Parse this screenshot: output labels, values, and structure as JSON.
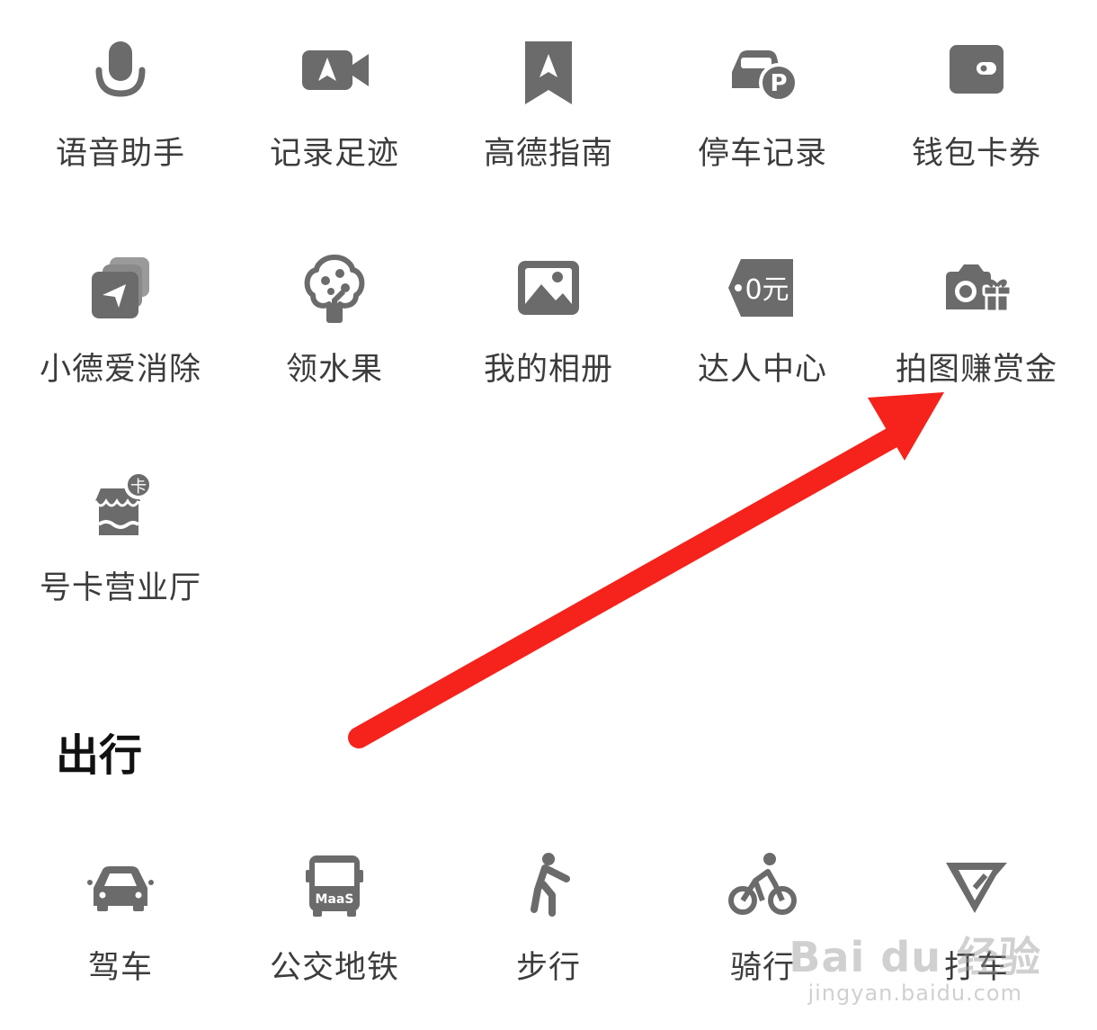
{
  "tools": [
    {
      "label": "语音助手",
      "icon": "microphone-icon"
    },
    {
      "label": "记录足迹",
      "icon": "video-camera-icon"
    },
    {
      "label": "高德指南",
      "icon": "bookmark-icon"
    },
    {
      "label": "停车记录",
      "icon": "car-parking-icon"
    },
    {
      "label": "钱包卡券",
      "icon": "wallet-icon"
    },
    {
      "label": "小德爱消除",
      "icon": "game-cards-icon"
    },
    {
      "label": "领水果",
      "icon": "fruit-tree-icon"
    },
    {
      "label": "我的相册",
      "icon": "photo-album-icon"
    },
    {
      "label": "达人中心",
      "icon": "price-tag-icon"
    },
    {
      "label": "拍图赚赏金",
      "icon": "camera-gift-icon"
    },
    {
      "label": "号卡营业厅",
      "icon": "shop-card-icon"
    }
  ],
  "price_tag_text": "0元",
  "shop_badge_text": "卡",
  "bus_badge_text": "MaaS",
  "travel_section": {
    "title": "出行",
    "items": [
      {
        "label": "驾车",
        "icon": "car-icon"
      },
      {
        "label": "公交地铁",
        "icon": "bus-icon"
      },
      {
        "label": "步行",
        "icon": "walk-icon"
      },
      {
        "label": "骑行",
        "icon": "cycling-icon"
      },
      {
        "label": "打车",
        "icon": "taxi-icon"
      }
    ]
  },
  "watermark": {
    "brand": "Bai du 经验",
    "url": "jingyan.baidu.com"
  },
  "colors": {
    "icon": "#6b6b6b",
    "label": "#3c3c3c",
    "arrow": "#f5231b"
  }
}
